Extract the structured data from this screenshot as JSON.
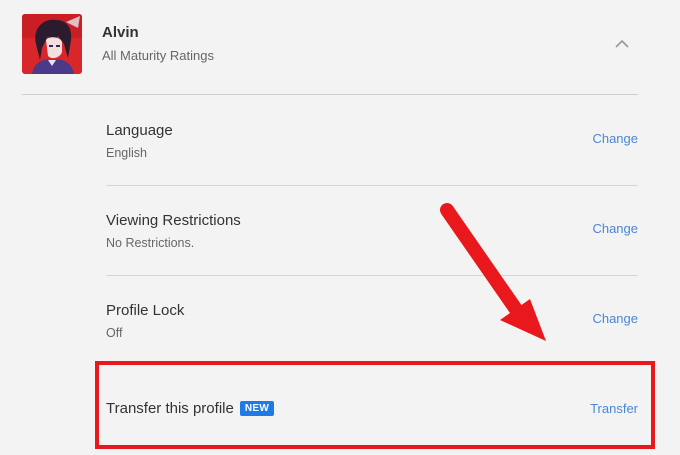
{
  "profile": {
    "name": "Alvin",
    "maturity": "All Maturity Ratings",
    "avatar_icon": "anime-avatar-icon",
    "collapse_icon": "chevron-up-icon"
  },
  "settings": {
    "language": {
      "title": "Language",
      "value": "English",
      "action": "Change"
    },
    "viewing_restrictions": {
      "title": "Viewing Restrictions",
      "value": "No Restrictions.",
      "action": "Change"
    },
    "profile_lock": {
      "title": "Profile Lock",
      "value": "Off",
      "action": "Change"
    },
    "transfer": {
      "title": "Transfer this profile",
      "badge": "NEW",
      "action": "Transfer"
    }
  },
  "colors": {
    "link": "#4a87d6",
    "badge": "#1f7ae8",
    "annotation_red": "#e8181d",
    "background": "#f3f3f3"
  }
}
